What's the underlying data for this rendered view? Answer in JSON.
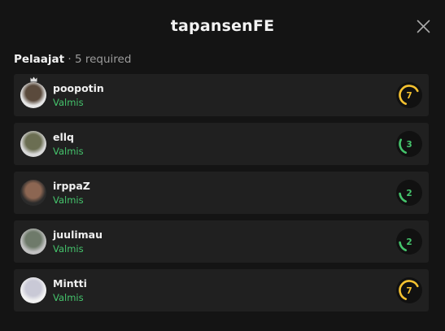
{
  "modal": {
    "title": "tapansenFE"
  },
  "section": {
    "label": "Pelaajat",
    "separator": "·",
    "requirement": "5 required"
  },
  "players": [
    {
      "name": "poopotin",
      "status": "Valmis",
      "level": "7",
      "level_color": "#f5c230",
      "is_leader": true,
      "avatar_colors": [
        "#e6e6e6",
        "#5a4a3c"
      ]
    },
    {
      "name": "ellq",
      "status": "Valmis",
      "level": "3",
      "level_color": "#45c46c",
      "is_leader": false,
      "avatar_colors": [
        "#d9d9d9",
        "#6b6e52"
      ]
    },
    {
      "name": "irppaZ",
      "status": "Valmis",
      "level": "2",
      "level_color": "#45c46c",
      "is_leader": false,
      "avatar_colors": [
        "#2b2b2b",
        "#8c6652"
      ]
    },
    {
      "name": "juulimau",
      "status": "Valmis",
      "level": "2",
      "level_color": "#45c46c",
      "is_leader": false,
      "avatar_colors": [
        "#c2c2c2",
        "#6e7a6a"
      ]
    },
    {
      "name": "Mintti",
      "status": "Valmis",
      "level": "7",
      "level_color": "#f5c230",
      "is_leader": false,
      "avatar_colors": [
        "#f2f2f2",
        "#c9c9d6"
      ]
    }
  ],
  "colors": {
    "background": "#141414",
    "row": "#202020",
    "ready": "#45c46c"
  },
  "icons": {
    "close": "close-icon",
    "leader": "crown-icon"
  }
}
